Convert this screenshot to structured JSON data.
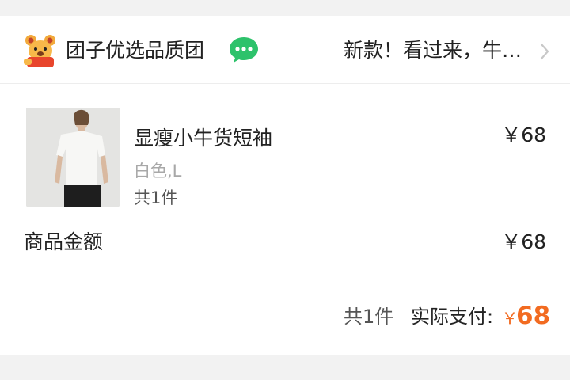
{
  "header": {
    "group_name": "团子优选品质团",
    "promo_text": "新款！看过来，牛…",
    "avatar_icon": "bear-mascot-icon",
    "chat_icon": "chat-bubble-icon",
    "chevron_icon": "chevron-right-icon"
  },
  "product": {
    "title": "显瘦小牛货短袖",
    "variant": "白色,L",
    "quantity": "共1件",
    "price": "￥68",
    "image_icon": "product-photo-white-tshirt"
  },
  "summary": {
    "amount_label": "商品金额",
    "amount_value": "￥68",
    "total_count": "共1件",
    "total_label": "实际支付:",
    "total_currency": "￥",
    "total_amount": "68"
  },
  "colors": {
    "accent": "#f26b21",
    "chat_green": "#2dc26b",
    "background": "#f2f2f2",
    "card": "#ffffff",
    "muted_text": "#a8a8a8"
  }
}
